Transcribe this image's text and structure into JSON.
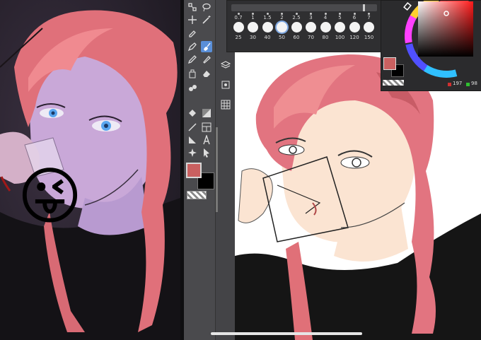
{
  "colors": {
    "primary_color": "#c96060",
    "secondary_color": "#000000",
    "app_bg": "#3d3d40",
    "accent": "#5a8fd8",
    "hair": "#e07078",
    "skin": "#fbe4d2"
  },
  "brush_sizes": {
    "labels": [
      "0.7",
      "1",
      "1.5",
      "2",
      "2.5",
      "3",
      "4",
      "5",
      "6",
      "7"
    ],
    "bottom": [
      "25",
      "30",
      "40",
      "50",
      "60",
      "70",
      "80",
      "100",
      "120",
      "150"
    ],
    "selected_index": 3
  },
  "color_panel": {
    "red_value": "197",
    "green_value": "98"
  },
  "tools": {
    "icons": [
      "transform-icon",
      "lasso-icon",
      "move-icon",
      "magic-wand-icon",
      "eyedropper-icon",
      "pen-icon",
      "brush-icon",
      "eraser-icon",
      "text-icon",
      "selection-icon",
      "fill-icon",
      "gradient-icon",
      "line-icon",
      "frame-icon",
      "shape-icon",
      "sparkle-icon",
      "pointer-icon"
    ]
  },
  "left_emoji": "😜"
}
